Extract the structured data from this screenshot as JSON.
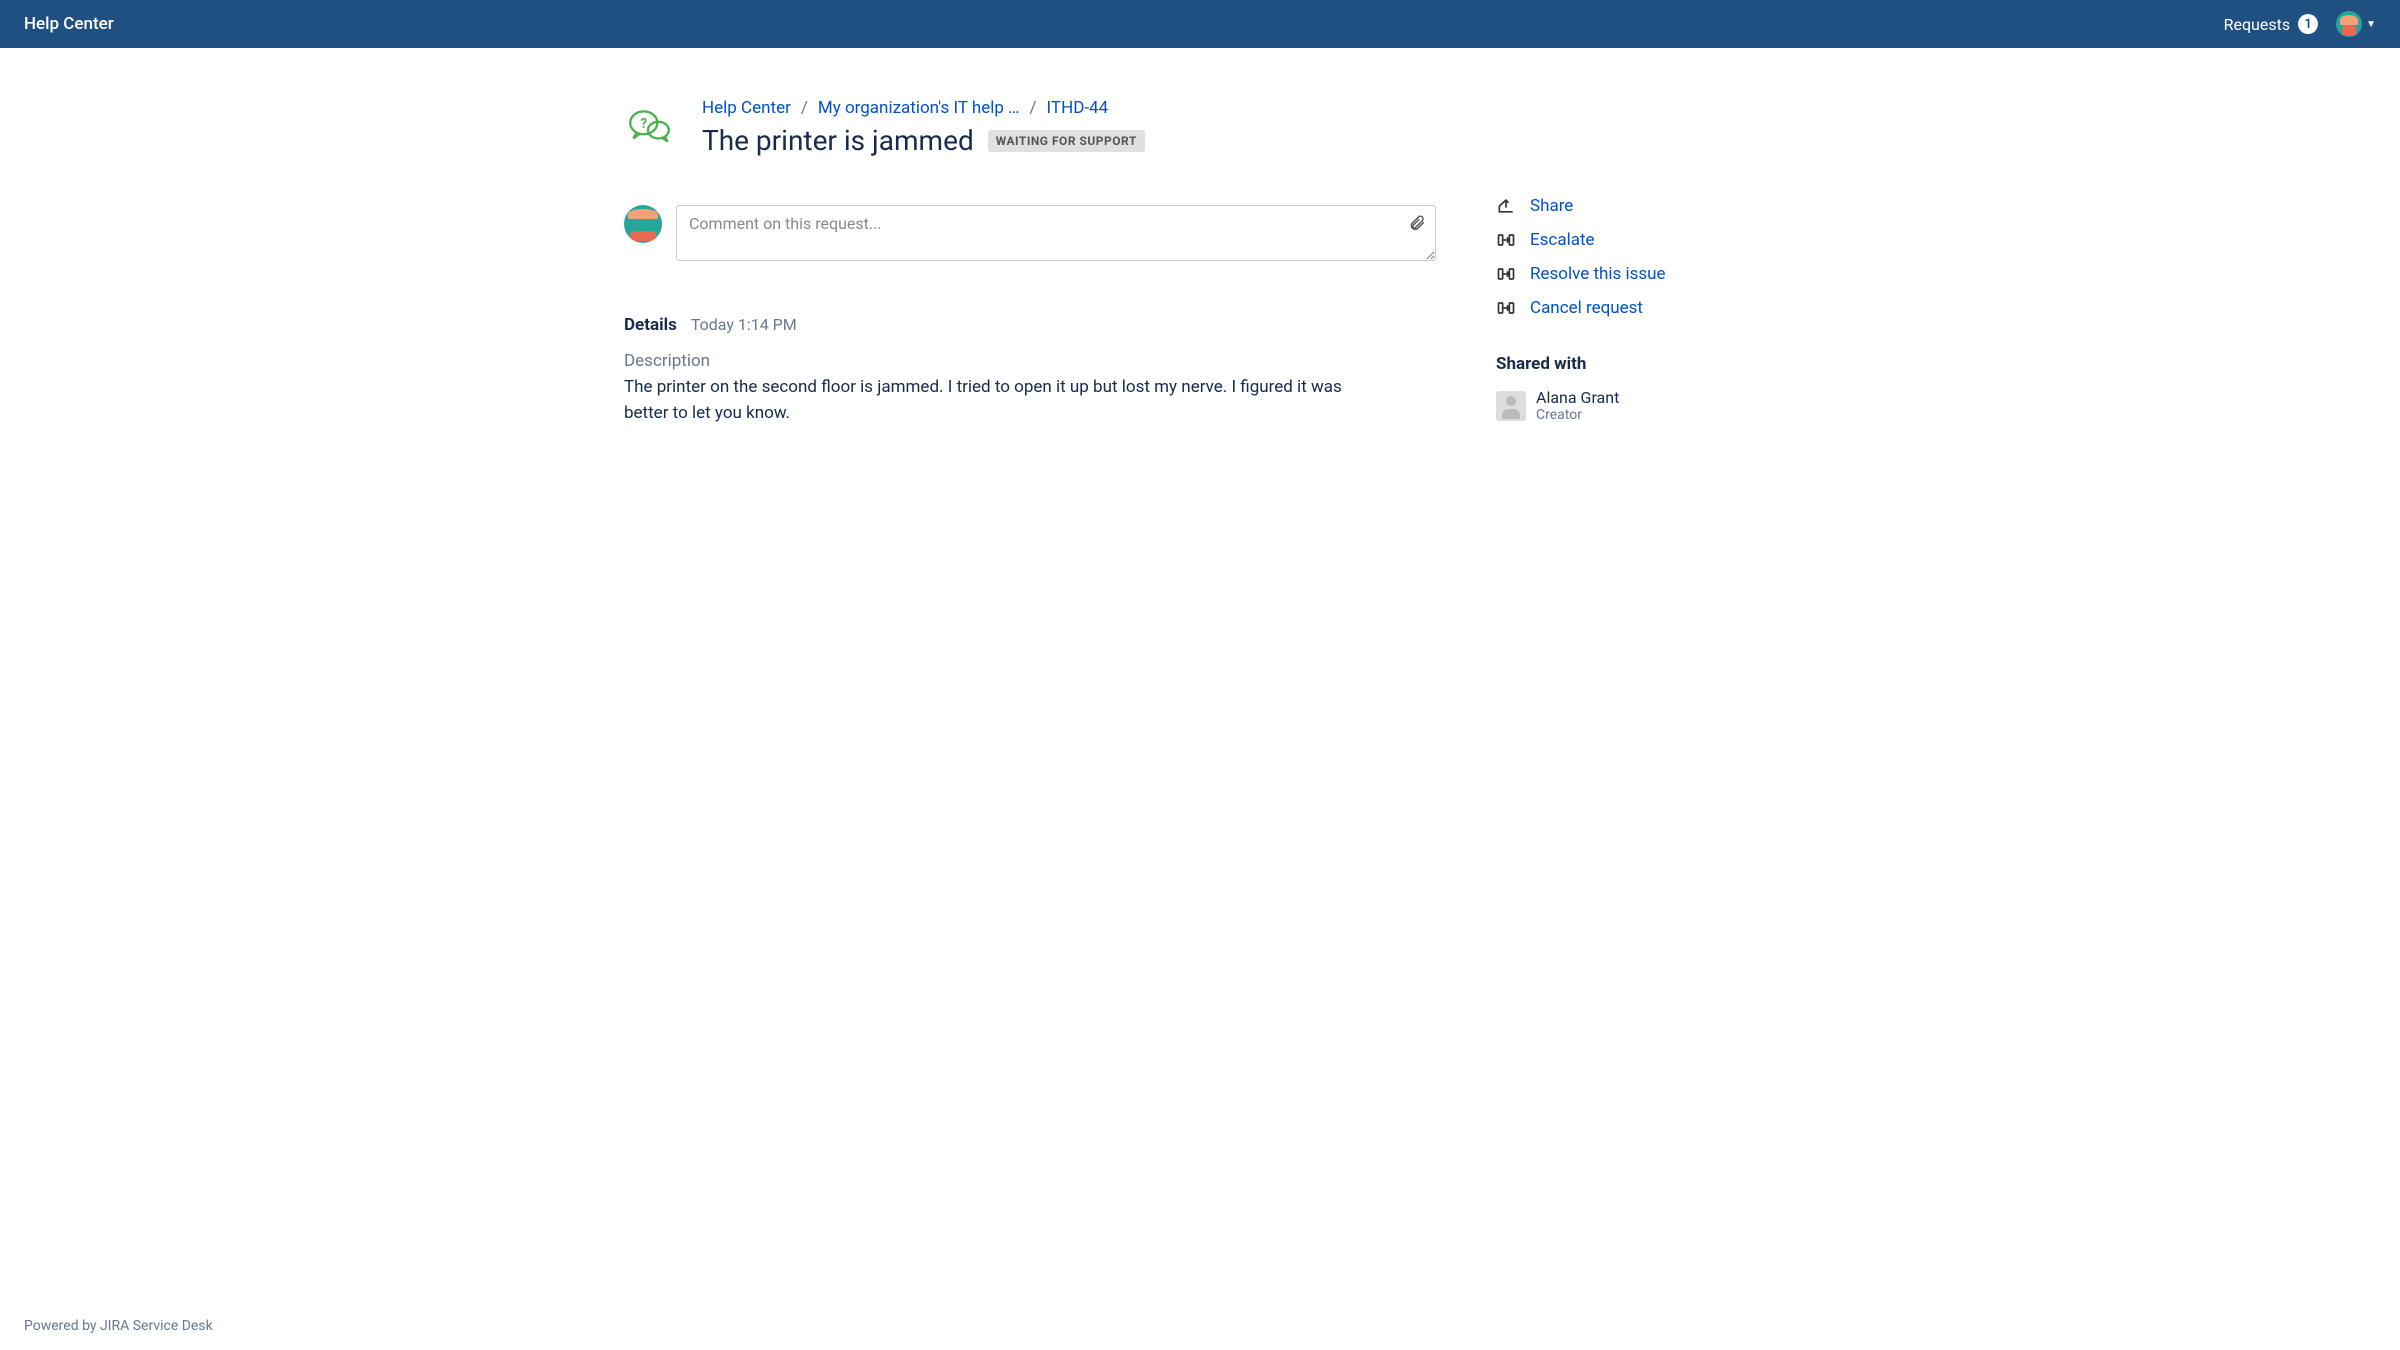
{
  "topbar": {
    "title": "Help Center",
    "requests_label": "Requests",
    "requests_count": "1"
  },
  "breadcrumbs": [
    {
      "label": "Help Center"
    },
    {
      "label": "My organization's IT help …"
    },
    {
      "label": "ITHD-44"
    }
  ],
  "request": {
    "title": "The printer is jammed",
    "status": "WAITING FOR SUPPORT"
  },
  "comment": {
    "placeholder": "Comment on this request..."
  },
  "details": {
    "heading": "Details",
    "timestamp": "Today 1:14 PM",
    "description_label": "Description",
    "description_text": "The printer on the second floor is jammed. I tried to open it up but lost my nerve. I figured it was better to let you know."
  },
  "actions": {
    "share": "Share",
    "escalate": "Escalate",
    "resolve": "Resolve this issue",
    "cancel": "Cancel request"
  },
  "shared_with": {
    "heading": "Shared with",
    "user_name": "Alana Grant",
    "user_role": "Creator"
  },
  "footer": "Powered by JIRA Service Desk"
}
